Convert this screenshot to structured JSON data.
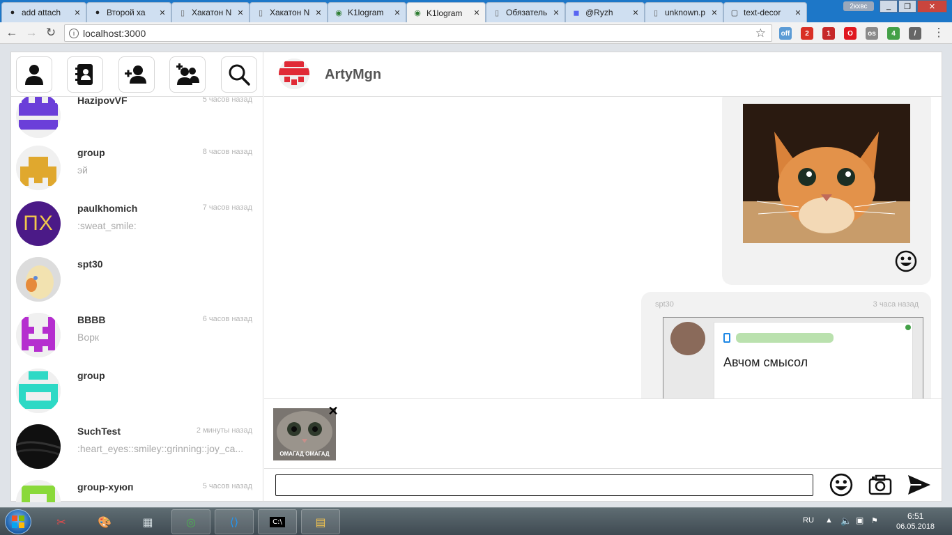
{
  "browser": {
    "tabs": [
      {
        "title": "add attach",
        "icon": "github-icon"
      },
      {
        "title": "Второй ха",
        "icon": "github-icon"
      },
      {
        "title": "Хакатон N",
        "icon": "document-icon"
      },
      {
        "title": "Хакатон N",
        "icon": "document-icon"
      },
      {
        "title": "K1logram",
        "icon": "k1logram-icon"
      },
      {
        "title": "K1logram",
        "icon": "k1logram-icon",
        "active": true
      },
      {
        "title": "Обязатель",
        "icon": "document-icon"
      },
      {
        "title": "@Ryzh",
        "icon": "discord-icon"
      },
      {
        "title": "unknown.p",
        "icon": "document-icon"
      },
      {
        "title": "text-decor",
        "icon": "comment-icon"
      }
    ],
    "profile_badge": "2кхвс",
    "url": "localhost:3000",
    "extensions": [
      {
        "name": "off-extension-icon",
        "label": "off",
        "color": "#5b9bd5"
      },
      {
        "name": "gmail-icon",
        "label": "2",
        "color": "#d93025"
      },
      {
        "name": "extension-red-icon",
        "label": "1",
        "color": "#c62828"
      },
      {
        "name": "opera-icon",
        "label": "O",
        "color": "#e0171f"
      },
      {
        "name": "os-icon",
        "label": "os",
        "color": "#8a8a8a"
      },
      {
        "name": "puzzle-icon",
        "label": "4",
        "color": "#43a047"
      },
      {
        "name": "eyedropper-icon",
        "label": "/",
        "color": "#666666"
      }
    ]
  },
  "app": {
    "nav_buttons": [
      {
        "name": "profile-button",
        "icon": "user-icon"
      },
      {
        "name": "contacts-button",
        "icon": "address-book-icon"
      },
      {
        "name": "add-contact-button",
        "icon": "user-plus-icon"
      },
      {
        "name": "create-group-button",
        "icon": "users-plus-icon"
      },
      {
        "name": "search-button",
        "icon": "search-icon"
      }
    ],
    "chats": [
      {
        "name": "HazipovVF",
        "time": "5 часов назад",
        "message": "",
        "avatar": "purple-identicon"
      },
      {
        "name": "group",
        "time": "8 часов назад",
        "message": "эй",
        "avatar": "yellow-identicon"
      },
      {
        "name": "paulkhomich",
        "time": "7 часов назад",
        "message": ":sweat_smile:",
        "avatar": "px-avatar",
        "avatar_text": "ПХ"
      },
      {
        "name": "spt30",
        "time": "",
        "message": "",
        "avatar": "photo-avatar"
      },
      {
        "name": "BBBB",
        "time": "6 часов назад",
        "message": "Ворк",
        "avatar": "magenta-identicon"
      },
      {
        "name": "group",
        "time": "",
        "message": "",
        "avatar": "teal-identicon"
      },
      {
        "name": "SuchTest",
        "time": "2 минуты назад",
        "message": ":heart_eyes::smiley::grinning::joy_ca...",
        "avatar": "black-photo-avatar"
      },
      {
        "name": "group-хуюп",
        "time": "5 часов назад",
        "message": "",
        "avatar": "green-identicon"
      }
    ],
    "active_chat": {
      "title": "ArtyMgn",
      "avatar": "red-identicon"
    },
    "messages": [
      {
        "type": "image",
        "image": "orange-cat-photo",
        "reaction_icon": "smiley-icon"
      },
      {
        "type": "image",
        "author": "spt30",
        "time": "3 часа назад",
        "image": "screenshot-photo",
        "image_text": "Авчом смысол"
      }
    ],
    "attachment": {
      "caption": "ОМАГАД ОМАГАД",
      "remove_icon": "close-icon"
    },
    "composer": {
      "value": "",
      "placeholder": "",
      "emoji_icon": "smiley-icon",
      "camera_icon": "camera-icon",
      "send_icon": "send-icon"
    }
  },
  "taskbar": {
    "apps": [
      "snipping-tool-icon",
      "paint-icon",
      "calculator-icon",
      "chrome-icon",
      "vscode-icon",
      "cmd-icon",
      "explorer-icon"
    ],
    "language": "RU",
    "time": "6:51",
    "date": "06.05.2018"
  }
}
